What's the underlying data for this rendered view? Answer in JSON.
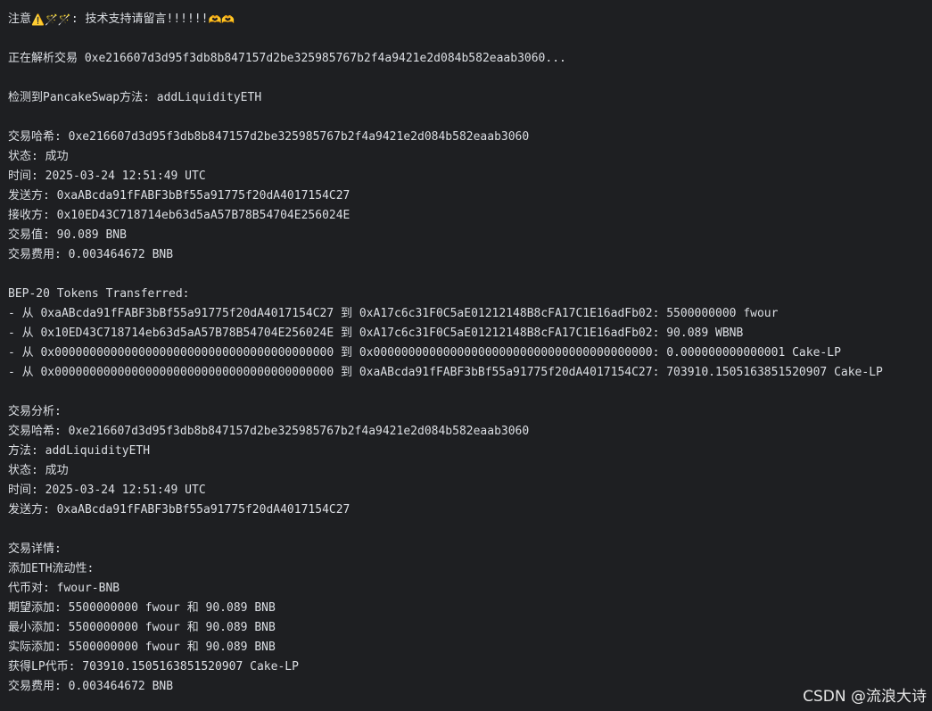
{
  "console": {
    "notice": {
      "prefix": "注意",
      "emoji_left": "⚠️🪄🪄",
      "text": ": 技术支持请留言!!!!!!",
      "emoji_right": "🫶🫶"
    },
    "parsing": "正在解析交易 0xe216607d3d95f3db8b847157d2be325985767b2f4a9421e2d084b582eaab3060...",
    "detected": "检测到PancakeSwap方法: addLiquidityETH",
    "tx_info": [
      "交易哈希: 0xe216607d3d95f3db8b847157d2be325985767b2f4a9421e2d084b582eaab3060",
      "状态: 成功",
      "时间: 2025-03-24 12:51:49 UTC",
      "发送方: 0xaABcda91fFABF3bBf55a91775f20dA4017154C27",
      "接收方: 0x10ED43C718714eb63d5aA57B78B54704E256024E",
      "交易值: 90.089 BNB",
      "交易费用: 0.003464672 BNB"
    ],
    "transfers_header": "BEP-20 Tokens Transferred:",
    "transfers": [
      "- 从 0xaABcda91fFABF3bBf55a91775f20dA4017154C27 到 0xA17c6c31F0C5aE01212148B8cFA17C1E16adFb02: 5500000000 fwour",
      "- 从 0x10ED43C718714eb63d5aA57B78B54704E256024E 到 0xA17c6c31F0C5aE01212148B8cFA17C1E16adFb02: 90.089 WBNB",
      "- 从 0x0000000000000000000000000000000000000000 到 0x0000000000000000000000000000000000000000: 0.000000000000001 Cake-LP",
      "- 从 0x0000000000000000000000000000000000000000 到 0xaABcda91fFABF3bBf55a91775f20dA4017154C27: 703910.1505163851520907 Cake-LP"
    ],
    "analysis_header": "交易分析:",
    "analysis": [
      "交易哈希: 0xe216607d3d95f3db8b847157d2be325985767b2f4a9421e2d084b582eaab3060",
      "方法: addLiquidityETH",
      "状态: 成功",
      "时间: 2025-03-24 12:51:49 UTC",
      "发送方: 0xaABcda91fFABF3bBf55a91775f20dA4017154C27"
    ],
    "details_header": "交易详情:",
    "details": [
      "添加ETH流动性:",
      "代币对: fwour-BNB",
      "期望添加: 5500000000 fwour 和 90.089 BNB",
      "最小添加: 5500000000 fwour 和 90.089 BNB",
      "实际添加: 5500000000 fwour 和 90.089 BNB",
      "获得LP代币: 703910.1505163851520907 Cake-LP",
      "交易费用: 0.003464672 BNB"
    ]
  },
  "watermark": "CSDN @流浪大诗"
}
